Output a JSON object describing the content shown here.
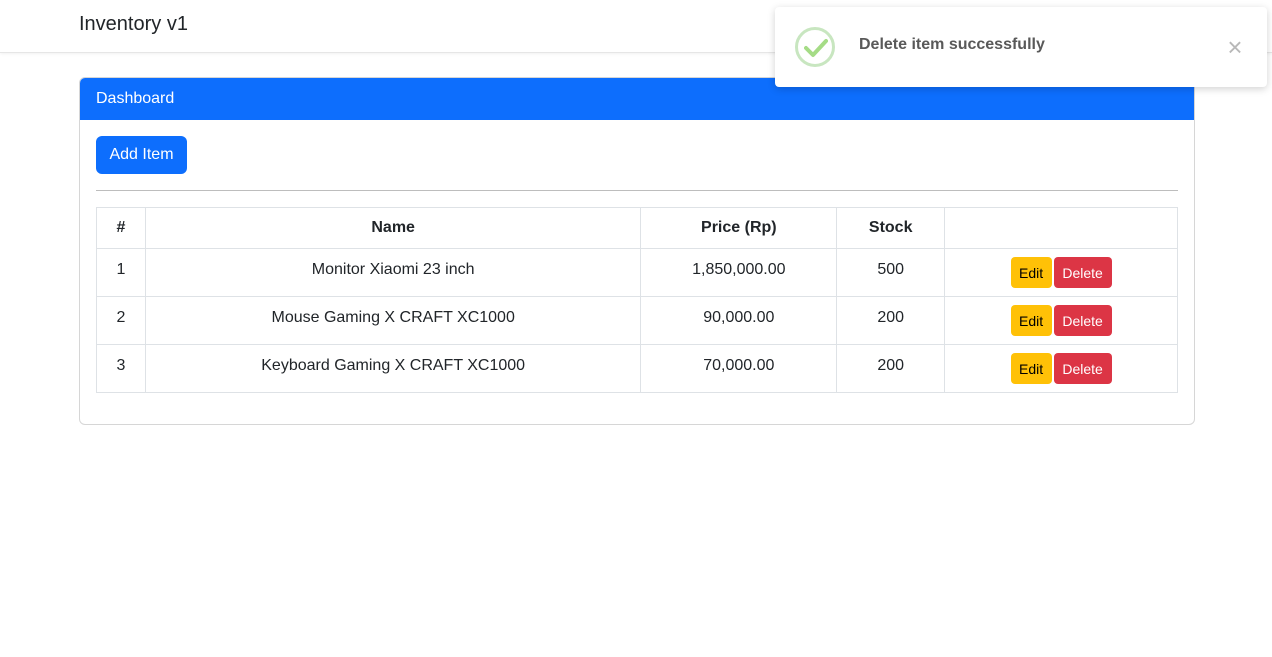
{
  "navbar": {
    "brand": "Inventory v1"
  },
  "card": {
    "header": "Dashboard",
    "add_button": "Add Item"
  },
  "table": {
    "headers": [
      "#",
      "Name",
      "Price (Rp)",
      "Stock",
      ""
    ],
    "rows": [
      {
        "no": "1",
        "name": "Monitor Xiaomi 23 inch",
        "price": "1,850,000.00",
        "stock": "500"
      },
      {
        "no": "2",
        "name": "Mouse Gaming X CRAFT XC1000",
        "price": "90,000.00",
        "stock": "200"
      },
      {
        "no": "3",
        "name": "Keyboard Gaming X CRAFT XC1000",
        "price": "70,000.00",
        "stock": "200"
      }
    ],
    "edit_label": "Edit",
    "delete_label": "Delete"
  },
  "toast": {
    "message": "Delete item successfully",
    "icon": "check-icon",
    "close_glyph": "×"
  },
  "colors": {
    "primary": "#0d6efd",
    "warning": "#ffc107",
    "danger": "#dc3545",
    "success": "#a5dc86"
  }
}
